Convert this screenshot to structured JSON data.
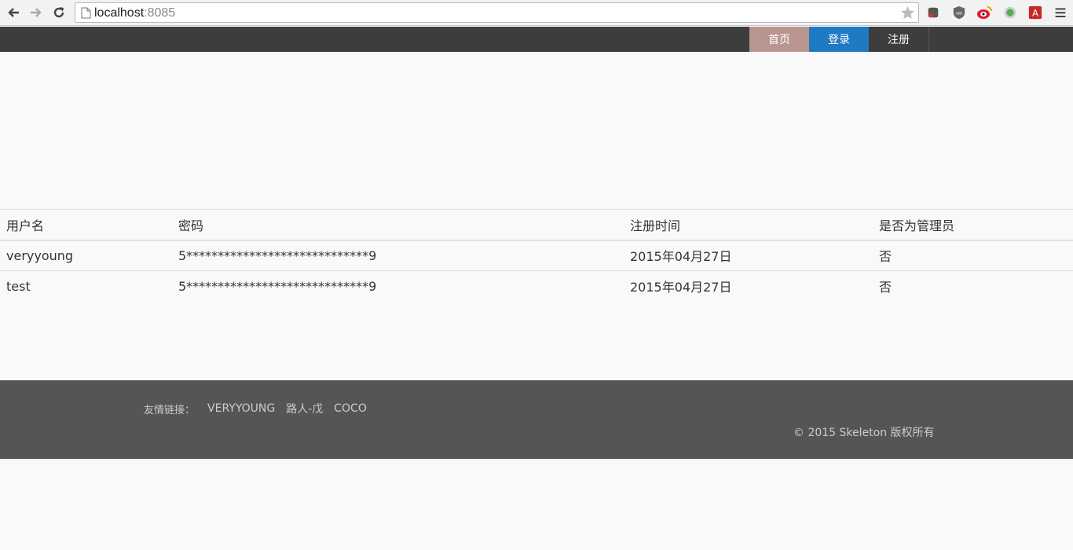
{
  "browser": {
    "url_host": "localhost",
    "url_port": ":8085"
  },
  "nav": {
    "home": "首页",
    "login": "登录",
    "register": "注册"
  },
  "colors": {
    "header_bg": "#3d3d3d",
    "home_bg": "#b99590",
    "login_bg": "#1f7ac4",
    "footer_bg": "#555555"
  },
  "table": {
    "headers": [
      "用户名",
      "密码",
      "注册时间",
      "是否为管理员"
    ],
    "rows": [
      [
        "veryyoung",
        "5*****************************9",
        "2015年04月27日",
        "否"
      ],
      [
        "test",
        "5*****************************9",
        "2015年04月27日",
        "否"
      ]
    ]
  },
  "footer": {
    "friend_label": "友情链接：",
    "links": [
      "VERYYOUNG",
      "路人-戊",
      "COCO"
    ],
    "copyright": "© 2015 Skeleton 版权所有"
  }
}
